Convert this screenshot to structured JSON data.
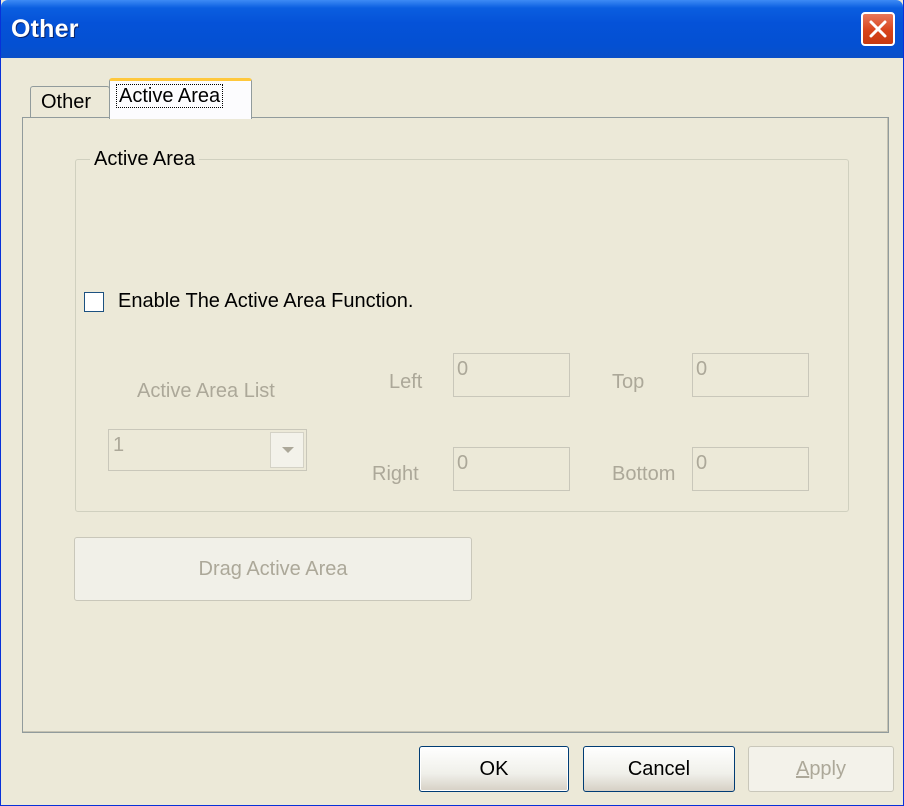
{
  "window": {
    "title": "Other",
    "close_icon": "close-icon"
  },
  "tabs": [
    {
      "label": "Other",
      "active": false
    },
    {
      "label": "Active Area",
      "active": true
    }
  ],
  "group": {
    "legend": "Active Area",
    "enable_checkbox": {
      "label": "Enable The Active Area Function.",
      "checked": false
    },
    "list_label": "Active Area List",
    "list_selected": "1",
    "fields": {
      "left": {
        "label": "Left",
        "value": "0"
      },
      "top": {
        "label": "Top",
        "value": "0"
      },
      "right": {
        "label": "Right",
        "value": "0"
      },
      "bottom": {
        "label": "Bottom",
        "value": "0"
      }
    }
  },
  "drag_button": {
    "label": "Drag Active Area",
    "enabled": false
  },
  "buttons": {
    "ok": "OK",
    "cancel": "Cancel",
    "apply_prefix": "A",
    "apply_rest": "pply"
  },
  "colors": {
    "titlebar": "#0552d8",
    "face": "#ece9d8",
    "disabled_text": "#aca899"
  }
}
